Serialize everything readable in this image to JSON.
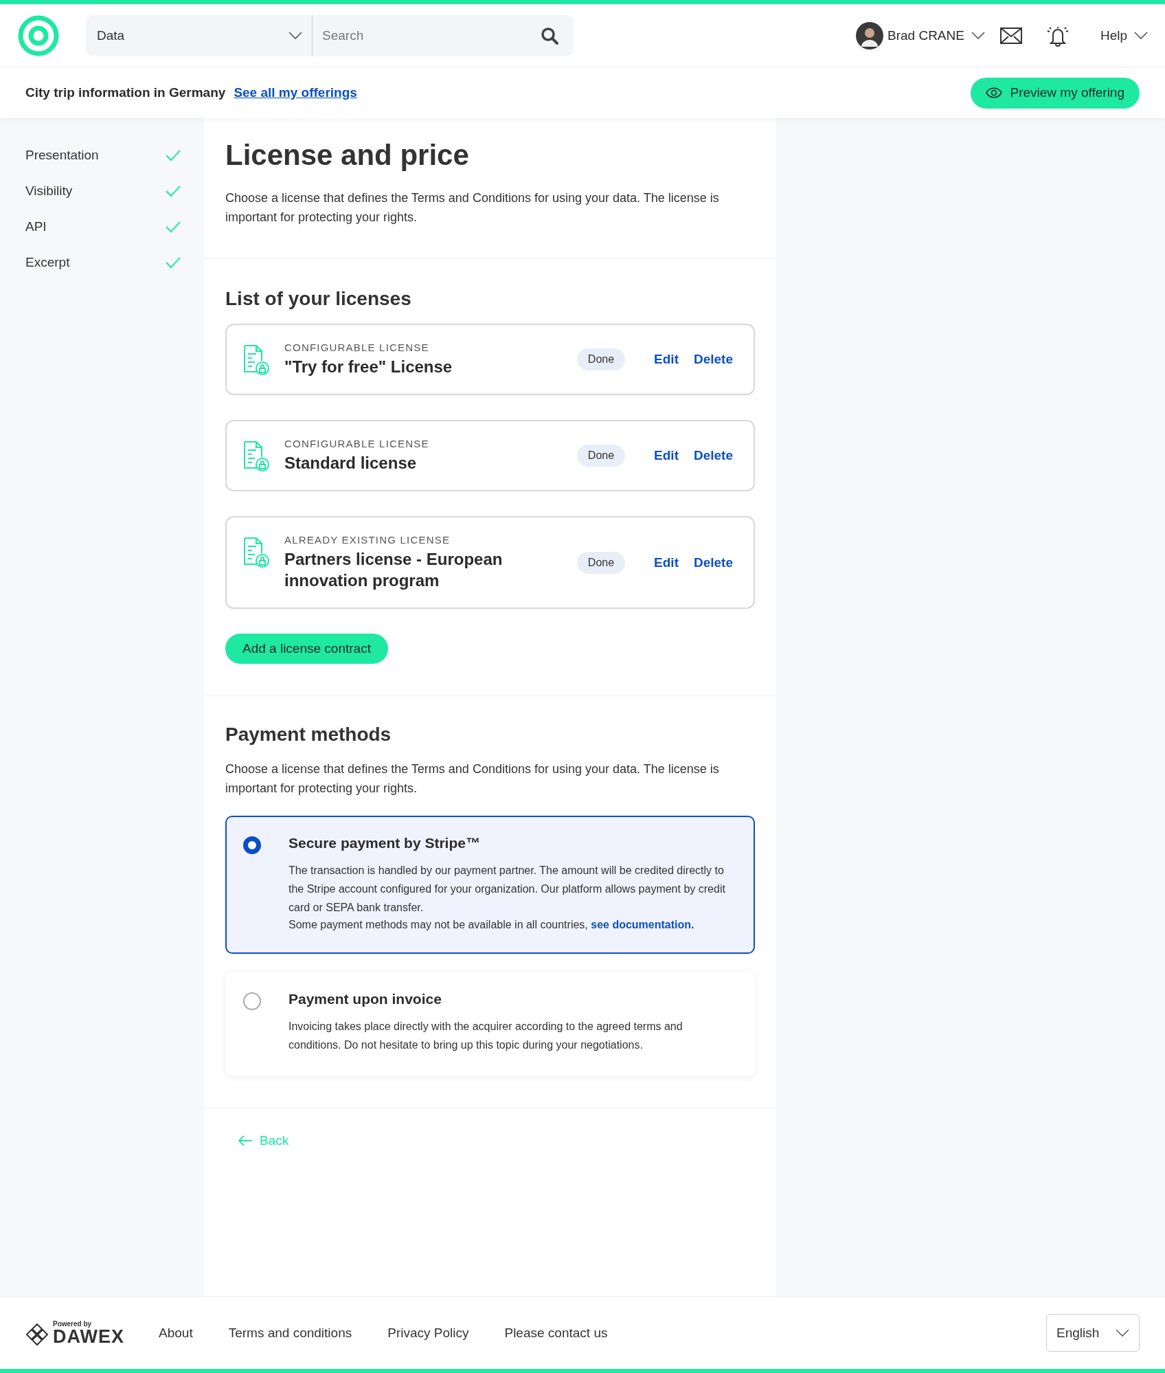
{
  "header": {
    "category_select": "Data",
    "search": {
      "placeholder": "Search"
    },
    "user": {
      "name": "Brad CRANE"
    },
    "help": "Help"
  },
  "subheader": {
    "offering_title": "City trip information in Germany",
    "offerings_link": "See all my offerings",
    "preview_button": "Preview my offering"
  },
  "sidebar": {
    "items": [
      {
        "label": "Presentation",
        "done": true
      },
      {
        "label": "Visibility",
        "done": true
      },
      {
        "label": "API",
        "done": true
      },
      {
        "label": "Excerpt",
        "done": true
      }
    ]
  },
  "intro": {
    "title": "License and price",
    "description": "Choose a license that defines the Terms and Conditions for using your data. The license is important for protecting your rights."
  },
  "licenses": {
    "title": "List of your licenses",
    "items": [
      {
        "type": "CONFIGURABLE LICENSE",
        "name": "\"Try for free\" License",
        "status": "Done",
        "actions": [
          "Edit",
          "Delete"
        ]
      },
      {
        "type": "CONFIGURABLE LICENSE",
        "name": "Standard license",
        "status": "Done",
        "actions": [
          "Edit",
          "Delete"
        ]
      },
      {
        "type": "ALREADY EXISTING LICENSE",
        "name": "Partners license - European innovation program",
        "status": "Done",
        "actions": [
          "Edit",
          "Delete"
        ]
      }
    ],
    "add_button": "Add a license contract"
  },
  "payment": {
    "title": "Payment methods",
    "description": "Choose a license that defines the Terms and Conditions for using your data. The license is important for protecting your rights.",
    "methods": [
      {
        "title": "Secure payment by Stripe™",
        "text": "The transaction is handled by our payment partner. The amount will be credited directly to the Stripe account configured for your organization. Our platform allows payment by credit card or SEPA bank transfer.",
        "note": "Some payment methods may not be available in all countries,",
        "link": "see documentation.",
        "selected": true
      },
      {
        "title": "Payment upon invoice",
        "text": "Invoicing takes place directly with the acquirer according to the agreed terms and conditions. Do not hesitate to bring up this topic during your negotiations.",
        "selected": false
      }
    ]
  },
  "back": "Back",
  "footer": {
    "powered_by": "Powered by",
    "brand": "DAWEX",
    "links": [
      "About",
      "Terms and conditions",
      "Privacy Policy",
      "Please contact us"
    ],
    "language": "English"
  }
}
